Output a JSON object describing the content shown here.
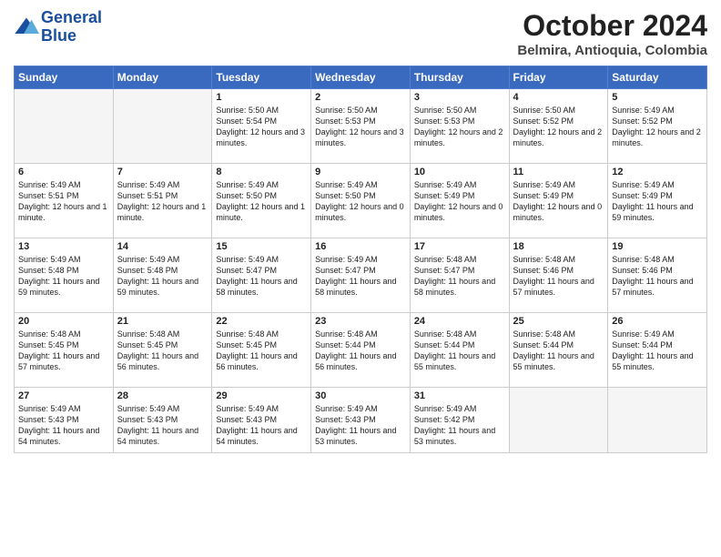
{
  "logo": {
    "line1": "General",
    "line2": "Blue"
  },
  "title": "October 2024",
  "location": "Belmira, Antioquia, Colombia",
  "days_header": [
    "Sunday",
    "Monday",
    "Tuesday",
    "Wednesday",
    "Thursday",
    "Friday",
    "Saturday"
  ],
  "weeks": [
    [
      {
        "day": "",
        "info": ""
      },
      {
        "day": "",
        "info": ""
      },
      {
        "day": "1",
        "info": "Sunrise: 5:50 AM\nSunset: 5:54 PM\nDaylight: 12 hours and 3 minutes."
      },
      {
        "day": "2",
        "info": "Sunrise: 5:50 AM\nSunset: 5:53 PM\nDaylight: 12 hours and 3 minutes."
      },
      {
        "day": "3",
        "info": "Sunrise: 5:50 AM\nSunset: 5:53 PM\nDaylight: 12 hours and 2 minutes."
      },
      {
        "day": "4",
        "info": "Sunrise: 5:50 AM\nSunset: 5:52 PM\nDaylight: 12 hours and 2 minutes."
      },
      {
        "day": "5",
        "info": "Sunrise: 5:49 AM\nSunset: 5:52 PM\nDaylight: 12 hours and 2 minutes."
      }
    ],
    [
      {
        "day": "6",
        "info": "Sunrise: 5:49 AM\nSunset: 5:51 PM\nDaylight: 12 hours and 1 minute."
      },
      {
        "day": "7",
        "info": "Sunrise: 5:49 AM\nSunset: 5:51 PM\nDaylight: 12 hours and 1 minute."
      },
      {
        "day": "8",
        "info": "Sunrise: 5:49 AM\nSunset: 5:50 PM\nDaylight: 12 hours and 1 minute."
      },
      {
        "day": "9",
        "info": "Sunrise: 5:49 AM\nSunset: 5:50 PM\nDaylight: 12 hours and 0 minutes."
      },
      {
        "day": "10",
        "info": "Sunrise: 5:49 AM\nSunset: 5:49 PM\nDaylight: 12 hours and 0 minutes."
      },
      {
        "day": "11",
        "info": "Sunrise: 5:49 AM\nSunset: 5:49 PM\nDaylight: 12 hours and 0 minutes."
      },
      {
        "day": "12",
        "info": "Sunrise: 5:49 AM\nSunset: 5:49 PM\nDaylight: 11 hours and 59 minutes."
      }
    ],
    [
      {
        "day": "13",
        "info": "Sunrise: 5:49 AM\nSunset: 5:48 PM\nDaylight: 11 hours and 59 minutes."
      },
      {
        "day": "14",
        "info": "Sunrise: 5:49 AM\nSunset: 5:48 PM\nDaylight: 11 hours and 59 minutes."
      },
      {
        "day": "15",
        "info": "Sunrise: 5:49 AM\nSunset: 5:47 PM\nDaylight: 11 hours and 58 minutes."
      },
      {
        "day": "16",
        "info": "Sunrise: 5:49 AM\nSunset: 5:47 PM\nDaylight: 11 hours and 58 minutes."
      },
      {
        "day": "17",
        "info": "Sunrise: 5:48 AM\nSunset: 5:47 PM\nDaylight: 11 hours and 58 minutes."
      },
      {
        "day": "18",
        "info": "Sunrise: 5:48 AM\nSunset: 5:46 PM\nDaylight: 11 hours and 57 minutes."
      },
      {
        "day": "19",
        "info": "Sunrise: 5:48 AM\nSunset: 5:46 PM\nDaylight: 11 hours and 57 minutes."
      }
    ],
    [
      {
        "day": "20",
        "info": "Sunrise: 5:48 AM\nSunset: 5:45 PM\nDaylight: 11 hours and 57 minutes."
      },
      {
        "day": "21",
        "info": "Sunrise: 5:48 AM\nSunset: 5:45 PM\nDaylight: 11 hours and 56 minutes."
      },
      {
        "day": "22",
        "info": "Sunrise: 5:48 AM\nSunset: 5:45 PM\nDaylight: 11 hours and 56 minutes."
      },
      {
        "day": "23",
        "info": "Sunrise: 5:48 AM\nSunset: 5:44 PM\nDaylight: 11 hours and 56 minutes."
      },
      {
        "day": "24",
        "info": "Sunrise: 5:48 AM\nSunset: 5:44 PM\nDaylight: 11 hours and 55 minutes."
      },
      {
        "day": "25",
        "info": "Sunrise: 5:48 AM\nSunset: 5:44 PM\nDaylight: 11 hours and 55 minutes."
      },
      {
        "day": "26",
        "info": "Sunrise: 5:49 AM\nSunset: 5:44 PM\nDaylight: 11 hours and 55 minutes."
      }
    ],
    [
      {
        "day": "27",
        "info": "Sunrise: 5:49 AM\nSunset: 5:43 PM\nDaylight: 11 hours and 54 minutes."
      },
      {
        "day": "28",
        "info": "Sunrise: 5:49 AM\nSunset: 5:43 PM\nDaylight: 11 hours and 54 minutes."
      },
      {
        "day": "29",
        "info": "Sunrise: 5:49 AM\nSunset: 5:43 PM\nDaylight: 11 hours and 54 minutes."
      },
      {
        "day": "30",
        "info": "Sunrise: 5:49 AM\nSunset: 5:43 PM\nDaylight: 11 hours and 53 minutes."
      },
      {
        "day": "31",
        "info": "Sunrise: 5:49 AM\nSunset: 5:42 PM\nDaylight: 11 hours and 53 minutes."
      },
      {
        "day": "",
        "info": ""
      },
      {
        "day": "",
        "info": ""
      }
    ]
  ]
}
